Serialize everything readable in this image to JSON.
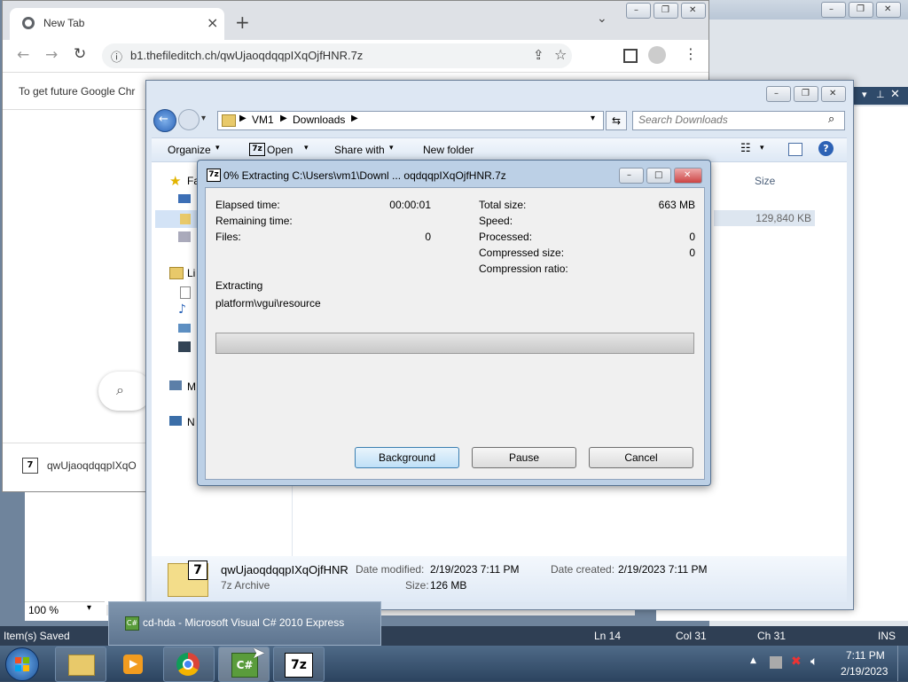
{
  "chrome": {
    "tab_title": "New Tab",
    "tab_close": "×",
    "new_tab": "+",
    "dropdown": "⌄",
    "url": "b1.thefileditch.ch/qwUjaoqdqqpIXqOjfHNR.7z",
    "info_bar_text": "To get future Google Chr",
    "download_item": "qwUjaoqdqqpIXqO"
  },
  "explorer": {
    "breadcrumb": [
      "VM1",
      "Downloads"
    ],
    "search_placeholder": "Search Downloads",
    "toolbar": {
      "organize": "Organize",
      "open": "Open",
      "share_with": "Share with",
      "new_folder": "New folder"
    },
    "column_size": "Size",
    "file_size": "129,840 KB",
    "nav_items": [
      "Fa",
      "Li",
      "M",
      "N"
    ],
    "details": {
      "filename": "qwUjaoqdqqpIXqOjfHNR",
      "type": "7z Archive",
      "date_modified_label": "Date modified:",
      "date_modified": "2/19/2023 7:11 PM",
      "date_created_label": "Date created:",
      "date_created": "2/19/2023 7:11 PM",
      "size_label": "Size:",
      "size": "126 MB"
    }
  },
  "dialog": {
    "title": "0% Extracting C:\\Users\\vm1\\Downl ... oqdqqpIXqOjfHNR.7z",
    "elapsed_label": "Elapsed time:",
    "elapsed_value": "00:00:01",
    "remaining_label": "Remaining time:",
    "files_label": "Files:",
    "files_value": "0",
    "total_size_label": "Total size:",
    "total_size_value": "663 MB",
    "speed_label": "Speed:",
    "processed_label": "Processed:",
    "processed_value": "0",
    "compressed_label": "Compressed size:",
    "compressed_value": "0",
    "ratio_label": "Compression ratio:",
    "extracting_label": "Extracting",
    "current_path": "platform\\vgui\\resource",
    "progress": 0,
    "buttons": {
      "background": "Background",
      "pause": "Pause",
      "cancel": "Cancel"
    }
  },
  "ide": {
    "zoom": "100 %",
    "status_left": "Item(s) Saved",
    "ln": "Ln 14",
    "col": "Col 31",
    "ch": "Ch 31",
    "ins": "INS"
  },
  "taskbar": {
    "popup_title": "cd-hda - Microsoft Visual C# 2010 Express",
    "clock_time": "7:11 PM",
    "clock_date": "2/19/2023"
  }
}
